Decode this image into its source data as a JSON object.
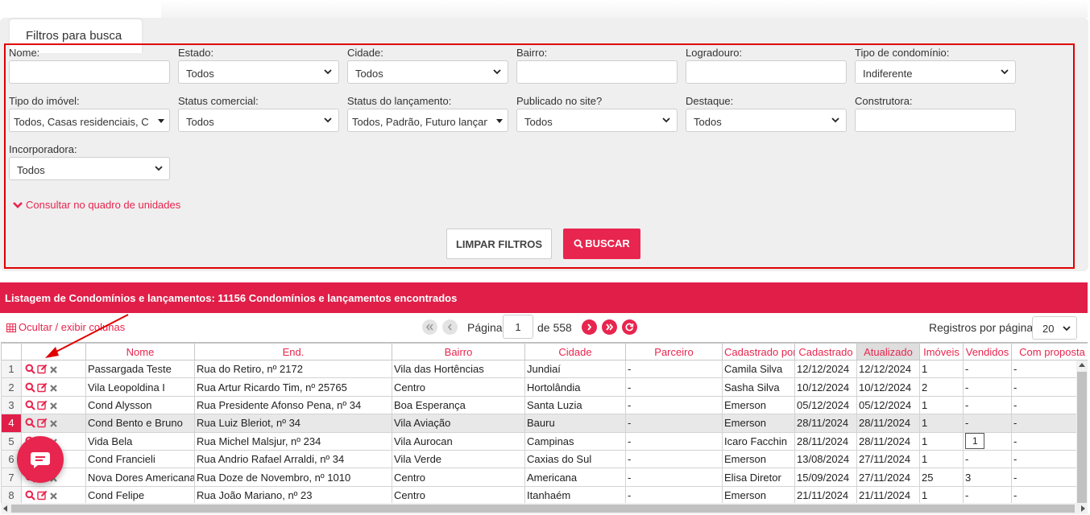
{
  "filter_panel": {
    "tab_label": "Filtros para busca",
    "fields": [
      {
        "label": "Nome:",
        "value": "",
        "type": "text"
      },
      {
        "label": "Estado:",
        "value": "Todos",
        "type": "select"
      },
      {
        "label": "Cidade:",
        "value": "Todos",
        "type": "select"
      },
      {
        "label": "Bairro:",
        "value": "",
        "type": "text"
      },
      {
        "label": "Logradouro:",
        "value": "",
        "type": "text"
      },
      {
        "label": "Tipo de condomínio:",
        "value": "Indiferente",
        "type": "select"
      },
      {
        "label": "Tipo do imóvel:",
        "value": "Todos, Casas residenciais, Ch",
        "type": "multiselect"
      },
      {
        "label": "Status comercial:",
        "value": "Todos",
        "type": "select"
      },
      {
        "label": "Status do lançamento:",
        "value": "Todos, Padrão, Futuro lançam",
        "type": "multiselect"
      },
      {
        "label": "Publicado no site?",
        "value": "Todos",
        "type": "select"
      },
      {
        "label": "Destaque:",
        "value": "Todos",
        "type": "select"
      },
      {
        "label": "Construtora:",
        "value": "",
        "type": "text"
      },
      {
        "label": "Incorporadora:",
        "value": "Todos",
        "type": "select"
      }
    ],
    "consult_link": "Consultar no quadro de unidades",
    "clear_button": "LIMPAR FILTROS",
    "search_button": "BUSCAR"
  },
  "listing": {
    "header": "Listagem de Condomínios e lançamentos: 11156 Condomínios e lançamentos encontrados",
    "toggle_columns": "Ocultar / exibir colunas",
    "pagination": {
      "page_label": "Página",
      "page": "1",
      "of_label": "de 558"
    },
    "rows_per_page_label": "Registros por página",
    "rows_per_page": "20",
    "columns": [
      "",
      "",
      "Nome",
      "End.",
      "Bairro",
      "Cidade",
      "Parceiro",
      "Cadastrado por",
      "Cadastrado",
      "Atualizado",
      "Imóveis",
      "Vendidos",
      "Com proposta"
    ],
    "rows": [
      {
        "n": "1",
        "nome": "Passargada Teste",
        "end": "Rua do Retiro, nº 2172",
        "bairro": "Vila das Hortências",
        "cidade": "Jundiaí",
        "parceiro": "-",
        "por": "Camila Silva",
        "cad": "12/12/2024",
        "atu": "12/12/2024",
        "imoveis": "1",
        "vendidos": "-",
        "proposta": "-"
      },
      {
        "n": "2",
        "nome": "Vila Leopoldina I",
        "end": "Rua Artur Ricardo Tim, nº 25765",
        "bairro": "Centro",
        "cidade": "Hortolândia",
        "parceiro": "-",
        "por": "Sasha Silva",
        "cad": "10/12/2024",
        "atu": "10/12/2024",
        "imoveis": "2",
        "vendidos": "-",
        "proposta": "-"
      },
      {
        "n": "3",
        "nome": "Cond Alysson",
        "end": "Rua Presidente Afonso Pena, nº 34",
        "bairro": "Boa Esperança",
        "cidade": "Santa Luzia",
        "parceiro": "-",
        "por": "Emerson",
        "cad": "05/12/2024",
        "atu": "05/12/2024",
        "imoveis": "1",
        "vendidos": "-",
        "proposta": "-"
      },
      {
        "n": "4",
        "nome": "Cond Bento e Bruno",
        "end": "Rua Luiz Bleriot, nº 34",
        "bairro": "Vila Aviação",
        "cidade": "Bauru",
        "parceiro": "-",
        "por": "Emerson",
        "cad": "28/11/2024",
        "atu": "28/11/2024",
        "imoveis": "1",
        "vendidos": "-",
        "proposta": "-"
      },
      {
        "n": "5",
        "nome": "Vida Bela",
        "end": "Rua Michel Malsjur, nº 234",
        "bairro": "Vila Aurocan",
        "cidade": "Campinas",
        "parceiro": "-",
        "por": "Icaro Facchin",
        "cad": "28/11/2024",
        "atu": "28/11/2024",
        "imoveis": "1",
        "vendidos": "1",
        "proposta": "-"
      },
      {
        "n": "6",
        "nome": "Cond Francieli",
        "end": "Rua Andrio Rafael Arraldi, nº 34",
        "bairro": "Vila Verde",
        "cidade": "Caxias do Sul",
        "parceiro": "-",
        "por": "Emerson",
        "cad": "13/08/2024",
        "atu": "27/11/2024",
        "imoveis": "1",
        "vendidos": "-",
        "proposta": "-"
      },
      {
        "n": "7",
        "nome": "Nova Dores Americana",
        "end": "Rua Doze de Novembro, nº 1010",
        "bairro": "Centro",
        "cidade": "Americana",
        "parceiro": "-",
        "por": "Elisa Diretor",
        "cad": "15/09/2024",
        "atu": "27/11/2024",
        "imoveis": "25",
        "vendidos": "3",
        "proposta": "-"
      },
      {
        "n": "8",
        "nome": "Cond Felipe",
        "end": "Rua João Mariano, nº 23",
        "bairro": "Centro",
        "cidade": "Itanhaém",
        "parceiro": "-",
        "por": "Emerson",
        "cad": "21/11/2024",
        "atu": "21/11/2024",
        "imoveis": "1",
        "vendidos": "-",
        "proposta": "-"
      }
    ],
    "selected_row": "4",
    "sorted_column": "Atualizado"
  },
  "colors": {
    "accent": "#e8254e",
    "header_bar": "#e01e48",
    "highlight_frame": "#e00000"
  }
}
